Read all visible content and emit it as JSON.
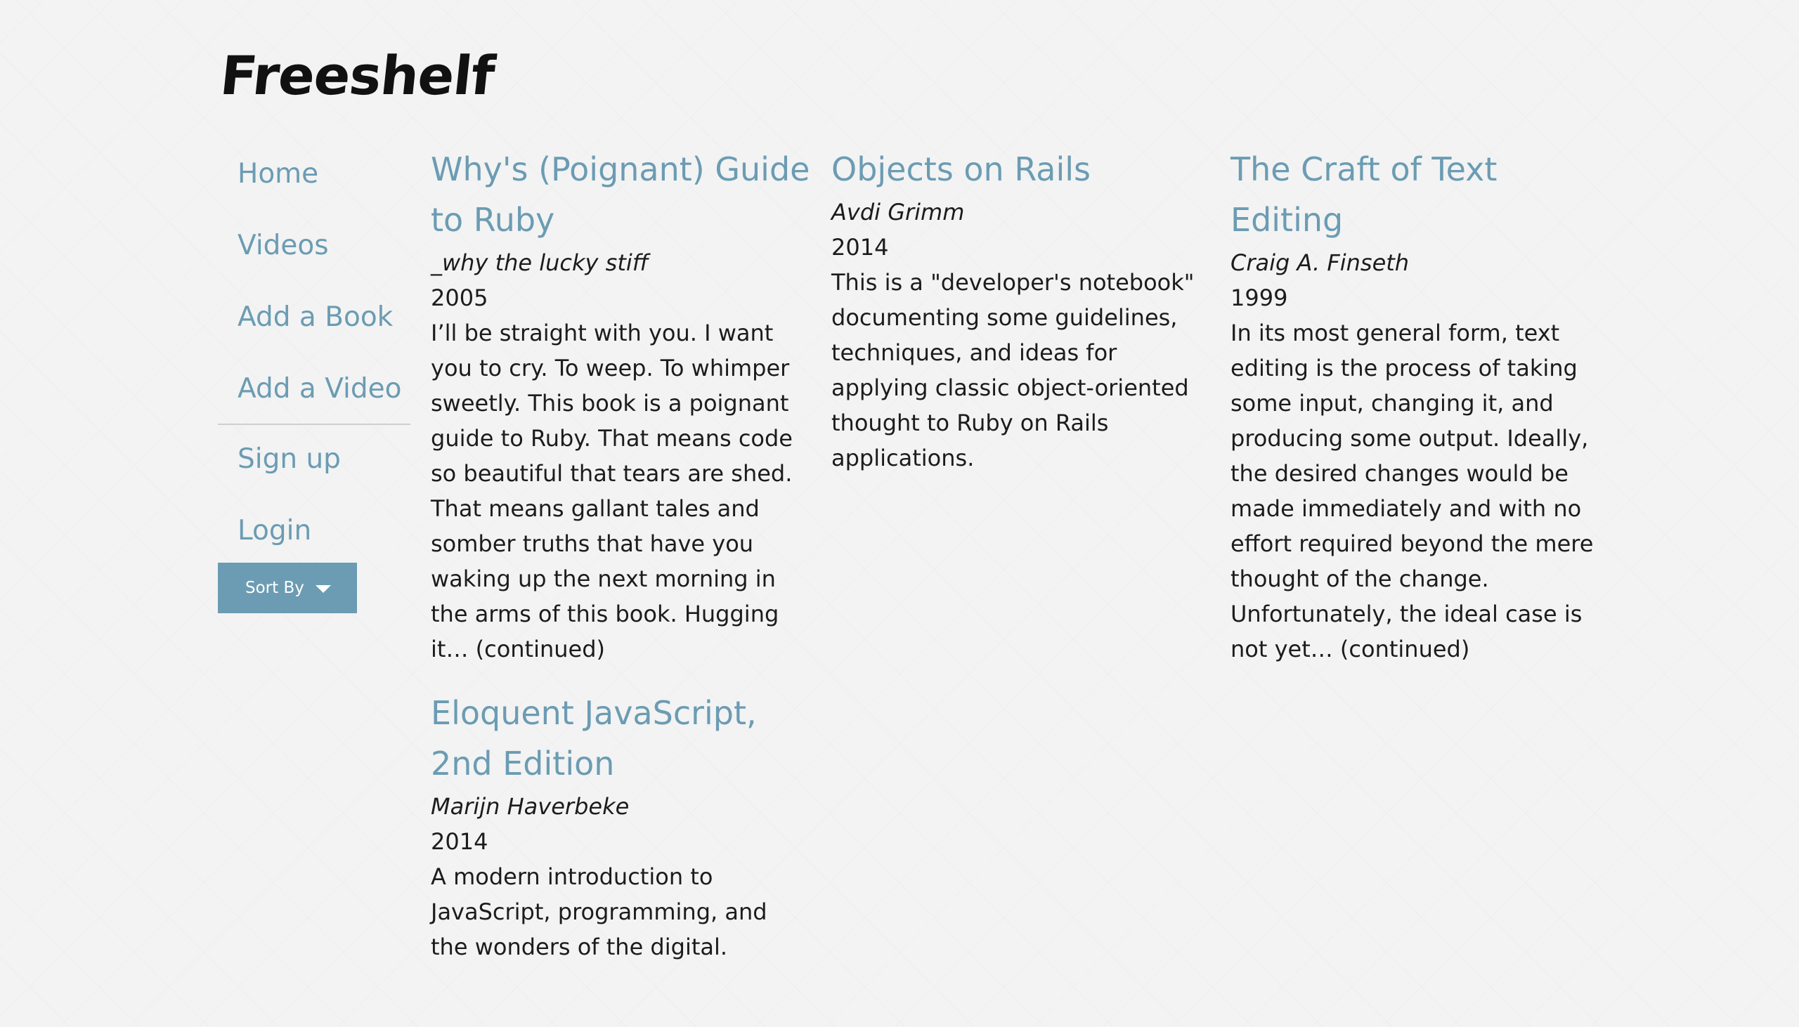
{
  "app": {
    "logo": "Freeshelf"
  },
  "sidebar": {
    "nav_items": [
      {
        "label": "Home"
      },
      {
        "label": "Videos"
      },
      {
        "label": "Add a Book"
      },
      {
        "label": "Add a Video"
      }
    ],
    "auth_items": [
      {
        "label": "Sign up"
      },
      {
        "label": "Login"
      }
    ],
    "sort_button": {
      "label": "Sort By",
      "icon": "caret-down-icon"
    }
  },
  "books": [
    {
      "title": "Why's (Poignant) Guide to Ruby",
      "author": "_why the lucky stiff",
      "year": "2005",
      "description": "I’ll be straight with you. I want you to cry. To weep. To whimper sweetly. This book is a poignant guide to Ruby. That means code so beautiful that tears are shed. That means gallant tales and somber truths that have you waking up the next morning in the arms of this book. Hugging it… (continued)"
    },
    {
      "title": "Objects on Rails",
      "author": "Avdi Grimm",
      "year": "2014",
      "description": "This is a \"developer's notebook\" documenting some guidelines, techniques, and ideas for applying classic object-oriented thought to Ruby on Rails applications."
    },
    {
      "title": "The Craft of Text Editing",
      "author": "Craig A. Finseth",
      "year": "1999",
      "description": "In its most general form, text editing is the process of taking some input, changing it, and producing some output. Ideally, the desired changes would be made immediately and with no effort required beyond the mere thought of the change. Unfortunately, the ideal case is not yet… (continued)"
    },
    {
      "title": "Eloquent JavaScript, 2nd Edition",
      "author": "Marijn Haverbeke",
      "year": "2014",
      "description": "A modern introduction to JavaScript, programming, and the wonders of the digital."
    }
  ],
  "colors": {
    "accent": "#6b9cb3",
    "background": "#f3f3f3",
    "text": "#1c1c1c"
  }
}
